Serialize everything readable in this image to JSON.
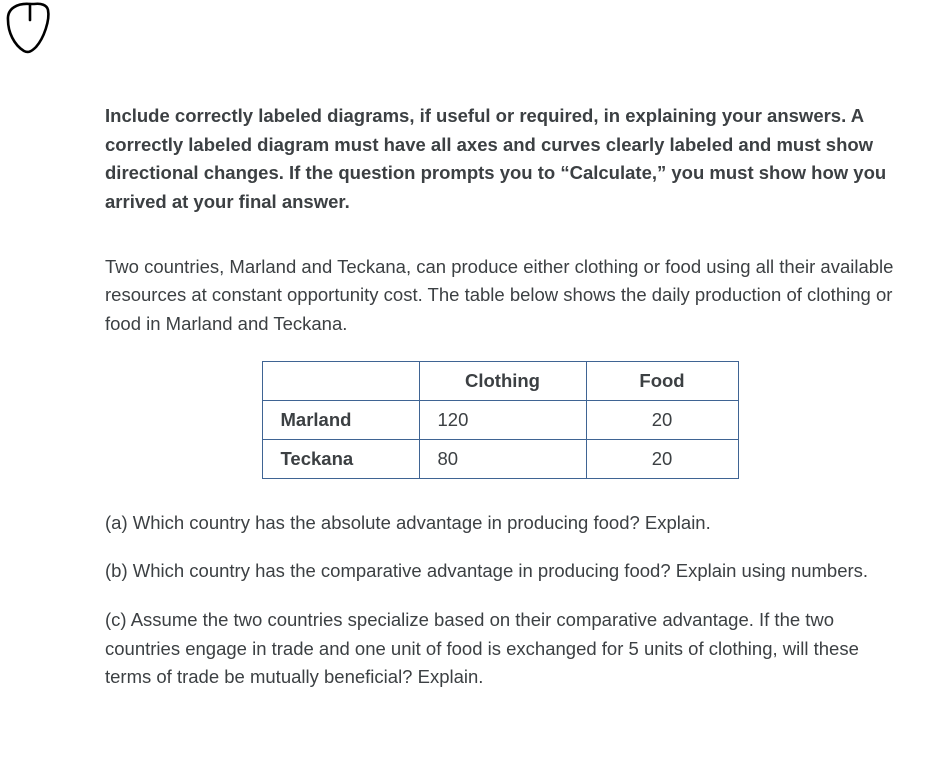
{
  "instructions": "Include correctly labeled diagrams, if useful or required, in explaining your answers. A correctly labeled diagram must have all axes and curves clearly labeled and must show directional changes. If the question prompts you to “Calculate,” you must show how you arrived at your final answer.",
  "intro": "Two countries, Marland and Teckana, can produce either clothing or food using all their available resources at constant opportunity cost. The table below shows the daily production of clothing or food in Marland and Teckana.",
  "table": {
    "headers": {
      "clothing": "Clothing",
      "food": "Food"
    },
    "rows": [
      {
        "country": "Marland",
        "clothing": "120",
        "food": "20"
      },
      {
        "country": "Teckana",
        "clothing": "80",
        "food": "20"
      }
    ]
  },
  "questions": {
    "a": "(a) Which country has the absolute advantage in producing food? Explain.",
    "b": "(b) Which country has the comparative advantage in producing food? Explain using numbers.",
    "c": "(c) Assume the two countries specialize based on their comparative advantage. If the two countries engage in trade and one unit of food is exchanged for 5 units of clothing, will these terms of trade be mutually beneficial? Explain."
  }
}
